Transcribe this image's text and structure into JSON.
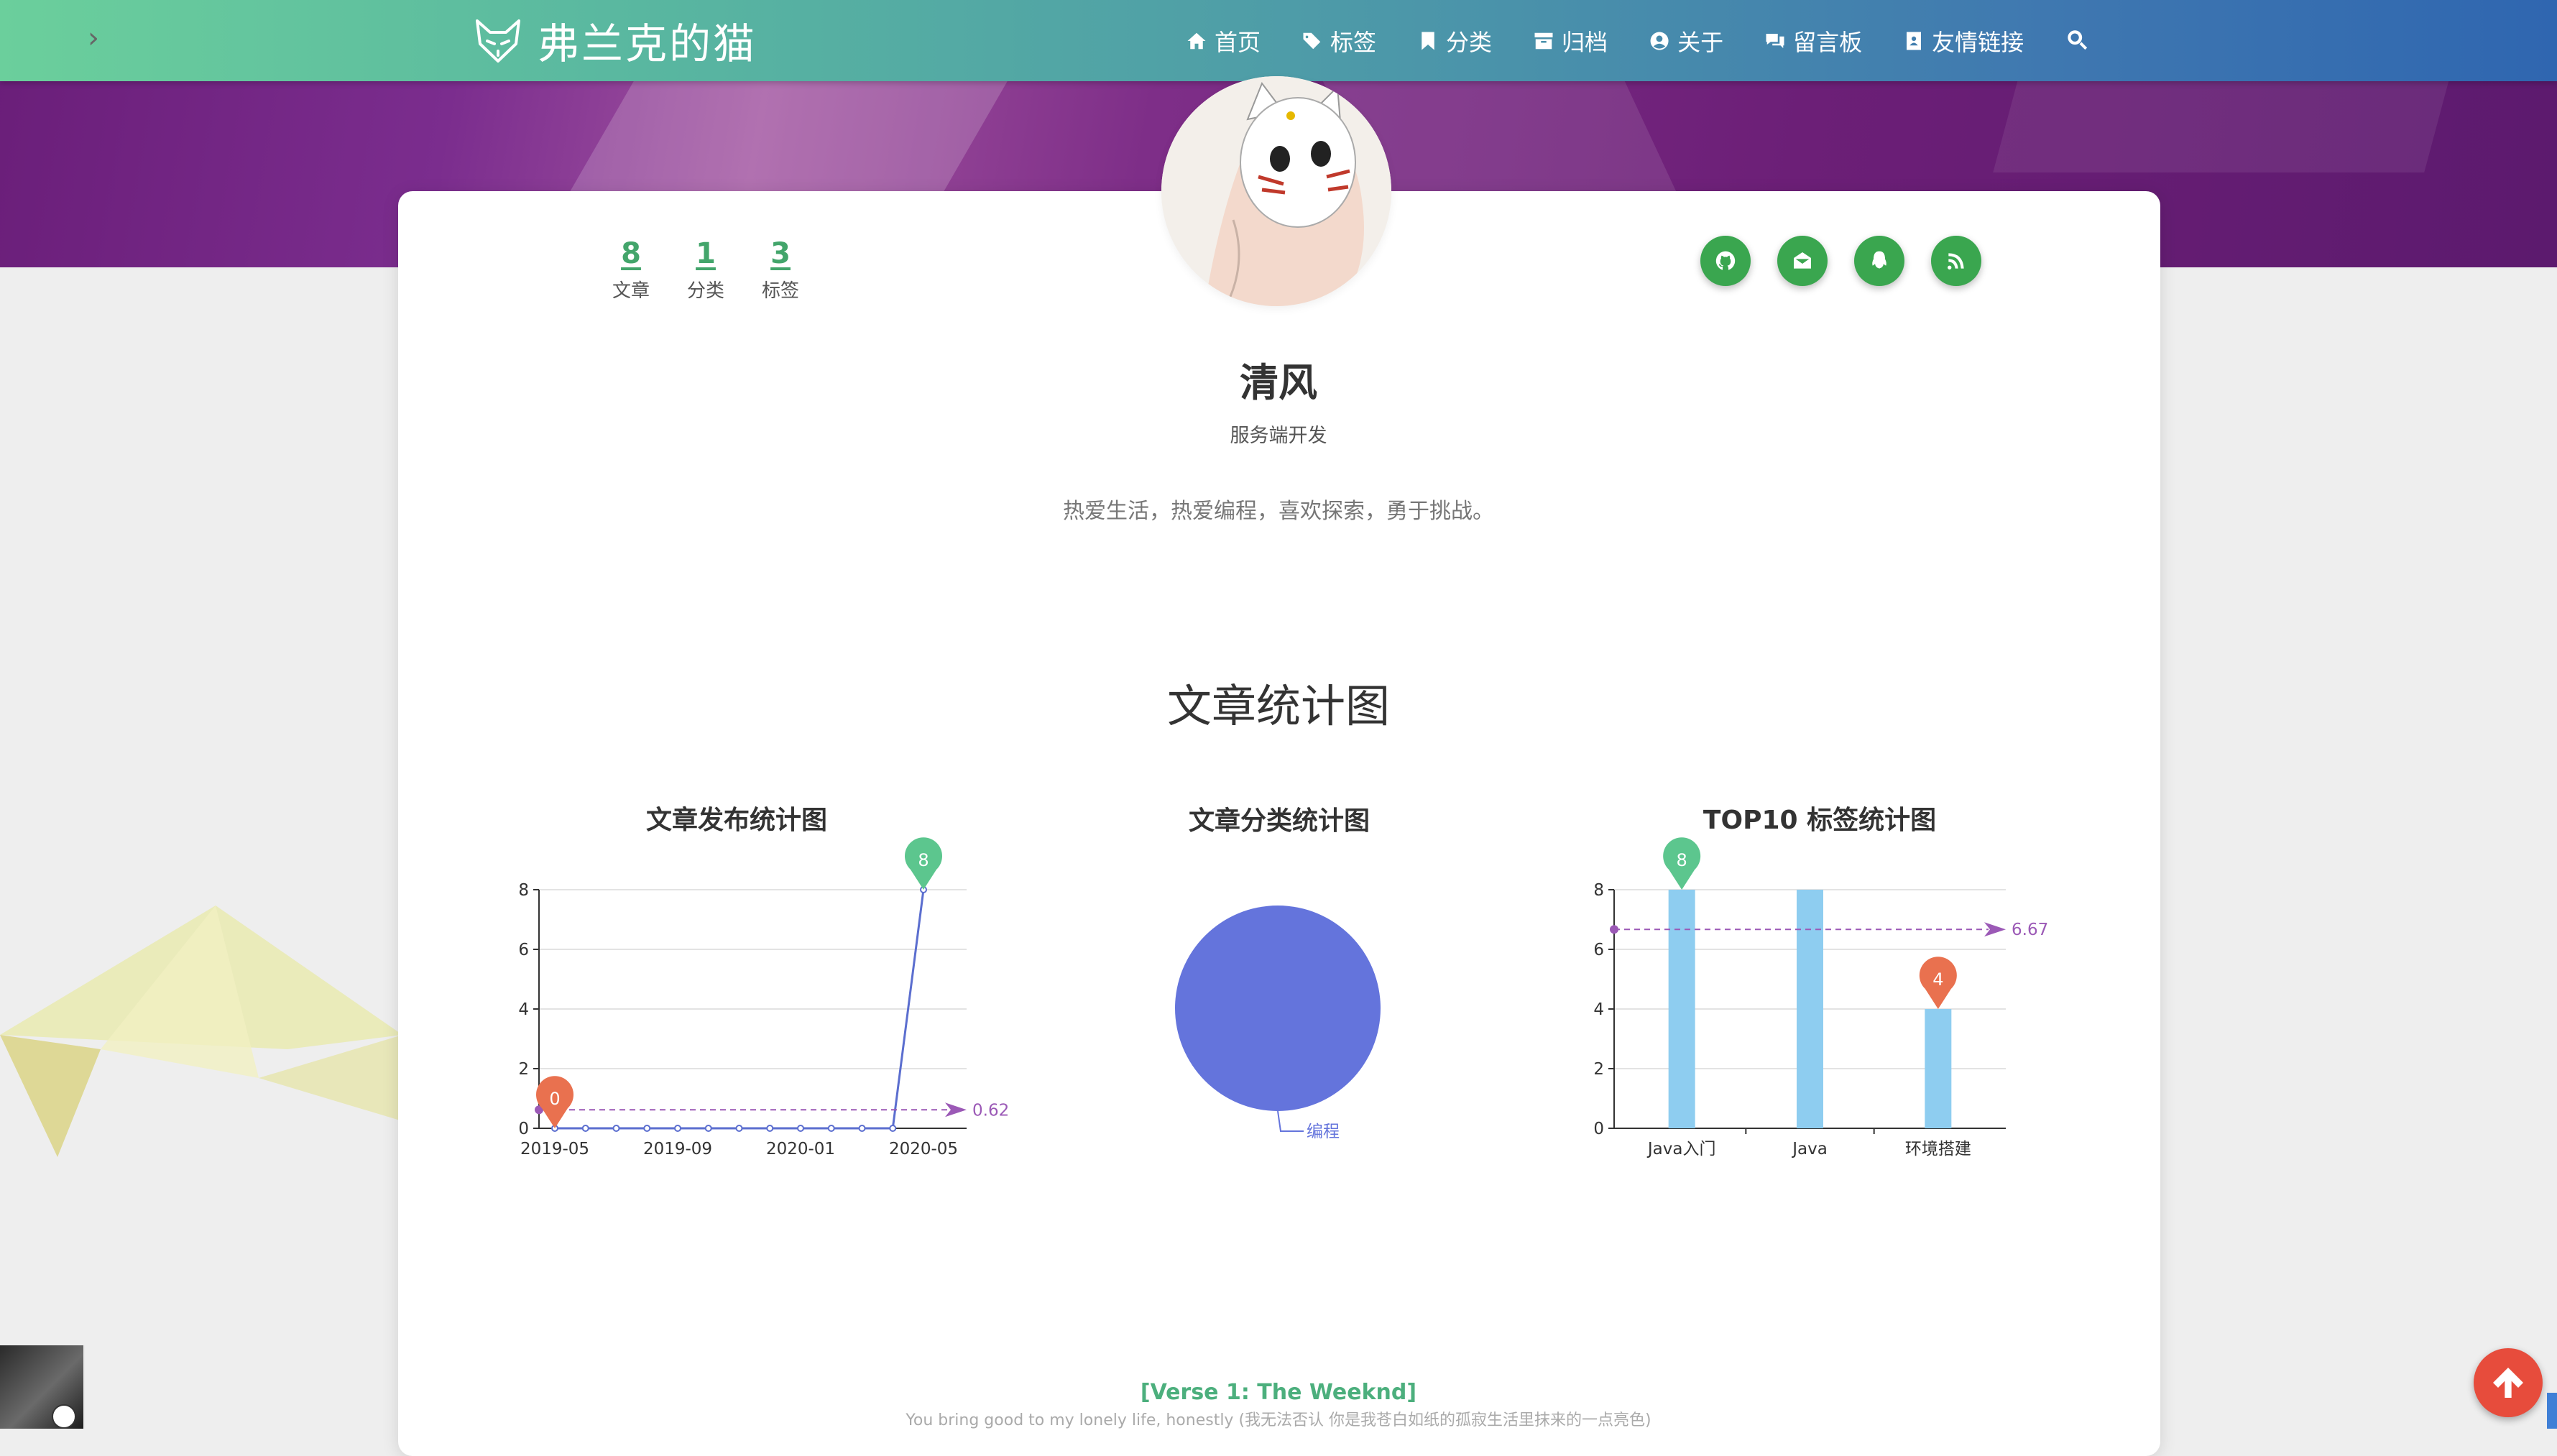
{
  "site": {
    "title": "弗兰克的猫",
    "logo_icon": "fox-icon"
  },
  "nav": {
    "items": [
      {
        "label": "首页",
        "icon": "home-icon"
      },
      {
        "label": "标签",
        "icon": "tags-icon"
      },
      {
        "label": "分类",
        "icon": "bookmark-icon"
      },
      {
        "label": "归档",
        "icon": "archive-icon"
      },
      {
        "label": "关于",
        "icon": "user-circle-icon"
      },
      {
        "label": "留言板",
        "icon": "comments-icon"
      },
      {
        "label": "友情链接",
        "icon": "address-book-icon"
      }
    ],
    "search_icon": "search-icon"
  },
  "profile": {
    "name": "清风",
    "job": "服务端开发",
    "bio": "热爱生活，热爱编程，喜欢探索，勇于挑战。",
    "stats": [
      {
        "value": "8",
        "label": "文章"
      },
      {
        "value": "1",
        "label": "分类"
      },
      {
        "value": "3",
        "label": "标签"
      }
    ],
    "socials": [
      "github-icon",
      "email-icon",
      "qq-icon",
      "rss-icon"
    ]
  },
  "section": {
    "title": "文章统计图"
  },
  "chart_data": [
    {
      "type": "line",
      "title": "文章发布统计图",
      "x": [
        "2019-05",
        "2019-06",
        "2019-07",
        "2019-08",
        "2019-09",
        "2019-10",
        "2019-11",
        "2019-12",
        "2020-01",
        "2020-02",
        "2020-03",
        "2020-04",
        "2020-05"
      ],
      "xticks": [
        "2019-05",
        "2019-09",
        "2020-01",
        "2020-05"
      ],
      "values": [
        0,
        0,
        0,
        0,
        0,
        0,
        0,
        0,
        0,
        0,
        0,
        0,
        8
      ],
      "ylim": [
        0,
        8
      ],
      "yticks": [
        0,
        2,
        4,
        6,
        8
      ],
      "max_marker": "8",
      "min_marker": "0",
      "average_label": "0.62",
      "average": 0.62,
      "color": "#5b6ecf",
      "grid": true
    },
    {
      "type": "pie",
      "title": "文章分类统计图",
      "slices": [
        {
          "name": "编程",
          "value": 8
        }
      ],
      "color": "#6474dc"
    },
    {
      "type": "bar",
      "title": "TOP10 标签统计图",
      "categories": [
        "Java入门",
        "Java",
        "环境搭建"
      ],
      "values": [
        8,
        8,
        4
      ],
      "ylim": [
        0,
        8
      ],
      "yticks": [
        0,
        2,
        4,
        6,
        8
      ],
      "max_marker": "8",
      "min_marker": "4",
      "average_label": "6.67",
      "average": 6.67,
      "color": "#8ecdf0",
      "grid": true
    }
  ],
  "lyrics": {
    "title": "[Verse 1: The Weeknd]",
    "line": "You bring good to my lonely life, honestly (我无法否认 你是我苍白如纸的孤寂生活里抹来的一点亮色)"
  },
  "player": {
    "arrow": "›"
  },
  "colors": {
    "accent": "#43a56b",
    "social": "#3aa64f",
    "max_pin": "#5cc68e",
    "min_pin": "#e9714f",
    "avg_line": "#9b59b6"
  }
}
